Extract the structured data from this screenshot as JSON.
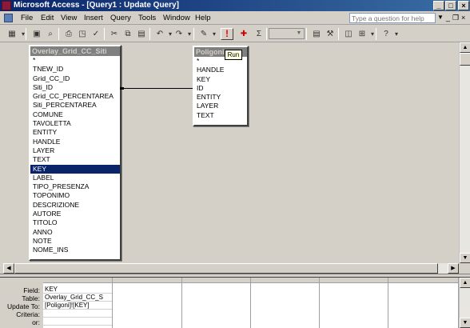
{
  "window": {
    "title": "Microsoft Access - [Query1 : Update Query]"
  },
  "menu": {
    "items": [
      {
        "label": "File"
      },
      {
        "label": "Edit"
      },
      {
        "label": "View"
      },
      {
        "label": "Insert"
      },
      {
        "label": "Query"
      },
      {
        "label": "Tools"
      },
      {
        "label": "Window"
      },
      {
        "label": "Help"
      }
    ],
    "help_placeholder": "Type a question for help",
    "close_glyph": "×"
  },
  "toolbar": {
    "run_icon": "!",
    "sigma_icon": "Σ",
    "tooltip": "Run"
  },
  "tables": [
    {
      "name": "Overlay_Grid_CC_Siti",
      "fields": [
        "*",
        "TNEW_ID",
        "Grid_CC_ID",
        "Siti_ID",
        "Grid_CC_PERCENTAREA",
        "Siti_PERCENTAREA",
        "COMUNE",
        "TAVOLETTA",
        "ENTITY",
        "HANDLE",
        "LAYER",
        "TEXT",
        "KEY",
        "LABEL",
        "TIPO_PRESENZA",
        "TOPONIMO",
        "DESCRIZIONE",
        "AUTORE",
        "TITOLO",
        "ANNO",
        "NOTE",
        "NOME_INS"
      ],
      "selected_field": "KEY"
    },
    {
      "name": "Poligoni",
      "fields": [
        "*",
        "HANDLE",
        "KEY",
        "ID",
        "ENTITY",
        "LAYER",
        "TEXT"
      ]
    }
  ],
  "grid": {
    "row_labels": [
      "Field:",
      "Table:",
      "Update To:",
      "Criteria:",
      "or:"
    ],
    "columns": [
      {
        "field": "KEY",
        "table": "Overlay_Grid_CC_S",
        "update_to": "[Poligoni]![KEY]",
        "criteria": "",
        "or": ""
      }
    ]
  }
}
